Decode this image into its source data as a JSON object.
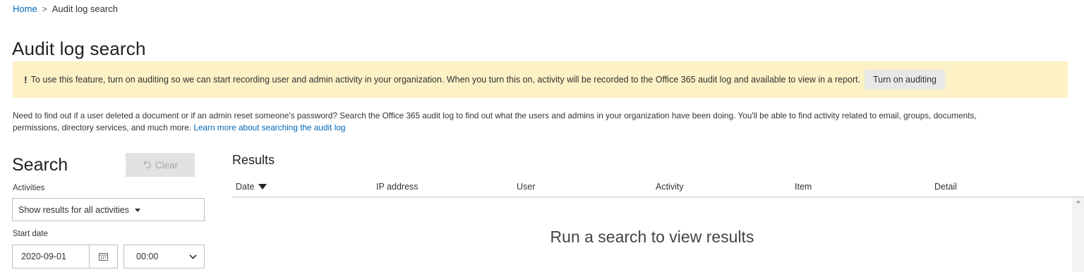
{
  "breadcrumb": {
    "home": "Home",
    "separator": ">",
    "current": "Audit log search"
  },
  "page_title": "Audit log search",
  "banner": {
    "icon": "!",
    "message": "To use this feature, turn on auditing so we can start recording user and admin activity in your organization. When you turn this on, activity will be recorded to the Office 365 audit log and available to view in a report.",
    "button_label": "Turn on auditing",
    "background": "#fdf1c6"
  },
  "intro": {
    "text_line1": "Need to find out if a user deleted a document or if an admin reset someone's password? Search the Office 365 audit log to find out what the users and admins in your organization have been doing. You'll be able to find activity related to email, groups, documents,",
    "text_line2": "permissions, directory services, and much more.",
    "link_text": "Learn more about searching the audit log"
  },
  "search": {
    "heading": "Search",
    "clear_label": "Clear",
    "activities_label": "Activities",
    "activities_value": "Show results for all activities",
    "start_date_label": "Start date",
    "start_date_value": "2020-09-01",
    "start_time_value": "00:00"
  },
  "results": {
    "heading": "Results",
    "columns": [
      "Date",
      "IP address",
      "User",
      "Activity",
      "Item",
      "Detail"
    ],
    "empty_message": "Run a search to view results"
  },
  "colors": {
    "link": "#0067b8",
    "banner": "#fdf1c6",
    "disabled_button": "#e2e2e2"
  }
}
